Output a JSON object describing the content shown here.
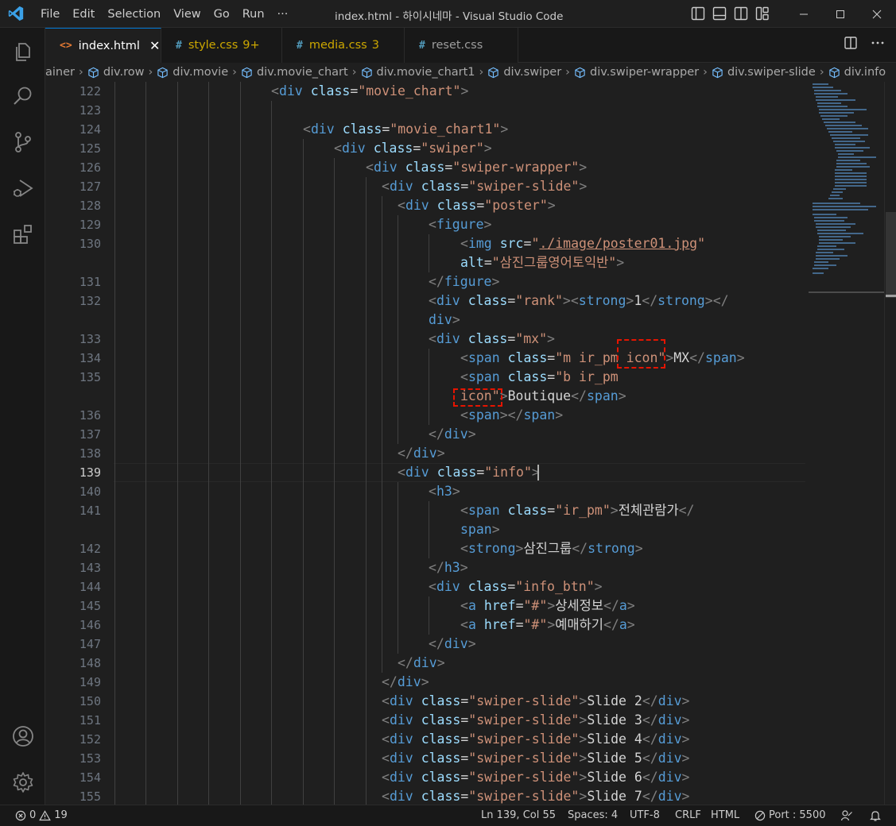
{
  "titlebar": {
    "menu": [
      "File",
      "Edit",
      "Selection",
      "View",
      "Go",
      "Run",
      "···"
    ],
    "title": "index.html - 하이시네마 - Visual Studio Code"
  },
  "tabs": [
    {
      "icon": "<>",
      "label": "index.html",
      "close": "✕",
      "active": true
    },
    {
      "icon": "#",
      "label": "style.css",
      "badge": "9+",
      "modified": true
    },
    {
      "icon": "#",
      "label": "media.css",
      "badge": "3",
      "modified": true
    },
    {
      "icon": "#",
      "label": "reset.css"
    }
  ],
  "breadcrumb": [
    "ainer",
    "div.row",
    "div.movie",
    "div.movie_chart",
    "div.movie_chart1",
    "div.swiper",
    "div.swiper-wrapper",
    "div.swiper-slide",
    "div.info"
  ],
  "editor": {
    "current_line": 139,
    "line_numbers": [
      122,
      123,
      124,
      125,
      126,
      127,
      128,
      129,
      130,
      "",
      131,
      132,
      "",
      133,
      134,
      135,
      "",
      136,
      137,
      138,
      139,
      140,
      141,
      "",
      142,
      143,
      144,
      145,
      146,
      147,
      148,
      149,
      150,
      151,
      152,
      153,
      154,
      155
    ]
  },
  "code": {
    "l122": {
      "open": "<",
      "tag": "div",
      "attr": "class",
      "eq": "=",
      "val": "\"movie_chart\"",
      "close": ">"
    },
    "l124": {
      "open": "<",
      "tag": "div",
      "attr": "class",
      "eq": "=",
      "val": "\"movie_chart1\"",
      "close": ">"
    },
    "l125": {
      "open": "<",
      "tag": "div",
      "attr": "class",
      "eq": "=",
      "val": "\"swiper\"",
      "close": ">"
    },
    "l126": {
      "open": "<",
      "tag": "div",
      "attr": "class",
      "eq": "=",
      "val": "\"swiper-wrapper\"",
      "close": ">"
    },
    "l127": {
      "open": "<",
      "tag": "div",
      "attr": "class",
      "eq": "=",
      "val": "\"swiper-slide\"",
      "close": ">"
    },
    "l128": {
      "open": "<",
      "tag": "div",
      "attr": "class",
      "eq": "=",
      "val": "\"poster\"",
      "close": ">"
    },
    "l129": {
      "open": "<",
      "tag": "figure",
      "close": ">"
    },
    "l130a": {
      "open": "<",
      "tag": "img",
      "attr": "src",
      "eq": "=",
      "q1": "\"",
      "val": "./image/poster01.jpg",
      "q2": "\""
    },
    "l130b": {
      "attr": "alt",
      "eq": "=",
      "val": "\"삼진그룹영어토익반\"",
      "close": ">"
    },
    "l131": {
      "open": "</",
      "tag": "figure",
      "close": ">"
    },
    "l132a": {
      "open": "<",
      "tag": "div",
      "attr": "class",
      "eq": "=",
      "val": "\"rank\"",
      "close": ">",
      "open2": "<",
      "tag2": "strong",
      "close2": ">",
      "text": "1",
      "open3": "</",
      "tag3": "strong",
      "close3": ">",
      "open4": "</"
    },
    "l132b": {
      "tag": "div",
      "close": ">"
    },
    "l133": {
      "open": "<",
      "tag": "div",
      "attr": "class",
      "eq": "=",
      "val": "\"mx\"",
      "close": ">"
    },
    "l134": {
      "open": "<",
      "tag": "span",
      "attr": "class",
      "eq": "=",
      "val": "\"m ir_pm icon\"",
      "close": ">",
      "text": "MX",
      "open2": "</",
      "tag2": "span",
      "close2": ">"
    },
    "l135a": {
      "open": "<",
      "tag": "span",
      "attr": "class",
      "eq": "=",
      "val": "\"b ir_pm"
    },
    "l135b": {
      "val": "icon\"",
      "close": ">",
      "text": "Boutique",
      "open2": "</",
      "tag2": "span",
      "close2": ">"
    },
    "l136": {
      "open": "<",
      "tag": "span",
      "close": ">",
      "open2": "</",
      "tag2": "span",
      "close2": ">"
    },
    "l137": {
      "open": "</",
      "tag": "div",
      "close": ">"
    },
    "l138": {
      "open": "</",
      "tag": "div",
      "close": ">"
    },
    "l139": {
      "open": "<",
      "tag": "div",
      "attr": "class",
      "eq": "=",
      "val": "\"info\"",
      "close": ">"
    },
    "l140": {
      "open": "<",
      "tag": "h3",
      "close": ">"
    },
    "l141a": {
      "open": "<",
      "tag": "span",
      "attr": "class",
      "eq": "=",
      "val": "\"ir_pm\"",
      "close": ">",
      "text": "전체관람가",
      "open2": "</"
    },
    "l141b": {
      "tag": "span",
      "close": ">"
    },
    "l142": {
      "open": "<",
      "tag": "strong",
      "close": ">",
      "text": "삼진그룹",
      "open2": "</",
      "tag2": "strong",
      "close2": ">"
    },
    "l143": {
      "open": "</",
      "tag": "h3",
      "close": ">"
    },
    "l144": {
      "open": "<",
      "tag": "div",
      "attr": "class",
      "eq": "=",
      "val": "\"info_btn\"",
      "close": ">"
    },
    "l145": {
      "open": "<",
      "tag": "a",
      "attr": "href",
      "eq": "=",
      "val": "\"#\"",
      "close": ">",
      "text": "상세정보",
      "open2": "</",
      "tag2": "a",
      "close2": ">"
    },
    "l146": {
      "open": "<",
      "tag": "a",
      "attr": "href",
      "eq": "=",
      "val": "\"#\"",
      "close": ">",
      "text": "예매하기",
      "open2": "</",
      "tag2": "a",
      "close2": ">"
    },
    "l147": {
      "open": "</",
      "tag": "div",
      "close": ">"
    },
    "l148": {
      "open": "</",
      "tag": "div",
      "close": ">"
    },
    "l149": {
      "open": "</",
      "tag": "div",
      "close": ">"
    },
    "l150": {
      "open": "<",
      "tag": "div",
      "attr": "class",
      "eq": "=",
      "val": "\"swiper-slide\"",
      "close": ">",
      "text": "Slide 2",
      "open2": "</",
      "tag2": "div",
      "close2": ">"
    },
    "l151": {
      "open": "<",
      "tag": "div",
      "attr": "class",
      "eq": "=",
      "val": "\"swiper-slide\"",
      "close": ">",
      "text": "Slide 3",
      "open2": "</",
      "tag2": "div",
      "close2": ">"
    },
    "l152": {
      "open": "<",
      "tag": "div",
      "attr": "class",
      "eq": "=",
      "val": "\"swiper-slide\"",
      "close": ">",
      "text": "Slide 4",
      "open2": "</",
      "tag2": "div",
      "close2": ">"
    },
    "l153": {
      "open": "<",
      "tag": "div",
      "attr": "class",
      "eq": "=",
      "val": "\"swiper-slide\"",
      "close": ">",
      "text": "Slide 5",
      "open2": "</",
      "tag2": "div",
      "close2": ">"
    },
    "l154": {
      "open": "<",
      "tag": "div",
      "attr": "class",
      "eq": "=",
      "val": "\"swiper-slide\"",
      "close": ">",
      "text": "Slide 6",
      "open2": "</",
      "tag2": "div",
      "close2": ">"
    },
    "l155": {
      "open": "<",
      "tag": "div",
      "attr": "class",
      "eq": "=",
      "val": "\"swiper-slide\"",
      "close": ">",
      "text": "Slide 7",
      "open2": "</",
      "tag2": "div",
      "close2": ">"
    }
  },
  "statusbar": {
    "errors": "0",
    "warnings": "19",
    "position": "Ln 139, Col 55",
    "spaces": "Spaces: 4",
    "encoding": "UTF-8",
    "eol": "CRLF",
    "language": "HTML",
    "port": "Port : 5500"
  },
  "colors": {
    "accent": "#0078d4",
    "highlight_box": "#e51400",
    "tag": "#569cd6",
    "attribute": "#9cdcfe",
    "string": "#ce9178"
  }
}
